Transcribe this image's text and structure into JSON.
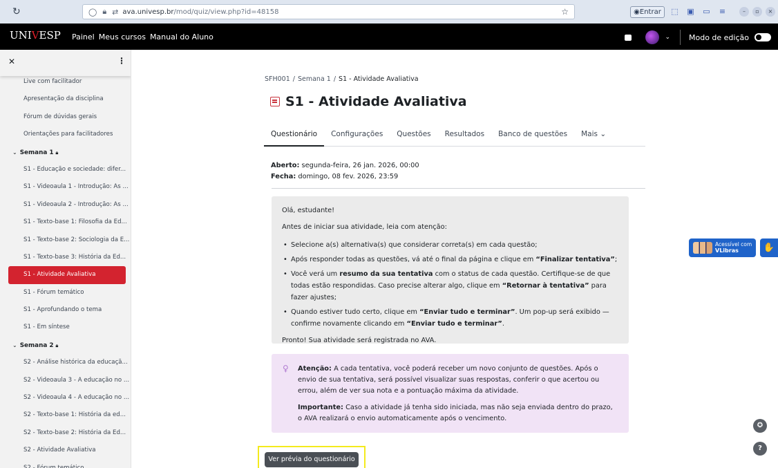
{
  "browser": {
    "url_host": "ava.univesp.br",
    "url_path": "/mod/quiz/view.php?id=48158",
    "entrar_label": "Entrar"
  },
  "navbar": {
    "logo_pre": "UNI",
    "logo_v": "V",
    "logo_post": "ESP",
    "links": [
      "Painel",
      "Meus cursos",
      "Manual do Aluno"
    ],
    "edit_mode_label": "Modo de edição"
  },
  "sidebar": {
    "items_top": [
      "Live com facilitador",
      "Apresentação da disciplina",
      "Fórum de dúvidas gerais",
      "Orientações para facilitadores"
    ],
    "section1": "Semana 1",
    "week1": [
      "S1 - Educação e sociedade: difer...",
      "S1 - Videoaula 1 - Introdução: As ...",
      "S1 - Videoaula 2 - Introdução: As ...",
      "S1 - Texto-base 1: Filosofia da Ed...",
      "S1 - Texto-base 2: Sociologia da E...",
      "S1 - Texto-base 3: História da Ed...",
      "S1 - Atividade Avaliativa",
      "S1 - Fórum temático",
      "S1 - Aprofundando o tema",
      "S1 - Em síntese"
    ],
    "section2": "Semana 2",
    "week2": [
      "S2 - Análise histórica da educaçã...",
      "S2 - Videoaula 3 - A educação no ...",
      "S2 - Videoaula 4 - A educação no ...",
      "S2 - Texto-base 1: História da ed...",
      "S2 - Texto-base 2: História da Ed...",
      "S2 - Atividade Avaliativa",
      "S2 - Fórum temático"
    ]
  },
  "breadcrumb": [
    "SFH001",
    "Semana 1",
    "S1 - Atividade Avaliativa"
  ],
  "title": "S1 - Atividade Avaliativa",
  "tabs": [
    "Questionário",
    "Configurações",
    "Questões",
    "Resultados",
    "Banco de questões",
    "Mais"
  ],
  "dates": {
    "open_label": "Aberto:",
    "open_value": "segunda-feira, 26 jan. 2026, 00:00",
    "close_label": "Fecha:",
    "close_value": "domingo, 08 fev. 2026, 23:59"
  },
  "info": {
    "greeting": "Olá, estudante!",
    "intro": "Antes de iniciar sua atividade, leia com atenção:",
    "b1": "Selecione a(s) alternativa(s) que considerar correta(s) em cada questão;",
    "b2_pre": "Após responder todas as questões, vá até o final da página e clique em ",
    "b2_bold": "“Finalizar tentativa”",
    "b2_post": ";",
    "b3_pre": "Você verá um ",
    "b3_bold1": "resumo da sua tentativa",
    "b3_mid": " com o status de cada questão. Certifique-se de que todas estão respondidas. Caso precise alterar algo, clique em ",
    "b3_bold2": "“Retornar à tentativa”",
    "b3_post": " para fazer ajustes;",
    "b4_pre": "Quando estiver tudo certo, clique em ",
    "b4_bold1": "“Enviar tudo e terminar”",
    "b4_mid": ". Um pop-up será exibido — confirme novamente clicando em ",
    "b4_bold2": "“Enviar tudo e terminar”",
    "b4_post": ".",
    "closing": "Pronto! Sua atividade será registrada no AVA."
  },
  "alert": {
    "p1_bold": "Atenção:",
    "p1_text": " A cada tentativa, você poderá receber um novo conjunto de questões. Após o envio de sua tentativa, será possível visualizar suas respostas, conferir o que acertou ou errou, além de ver sua nota e a pontuação máxima da atividade.",
    "p2_bold": "Importante:",
    "p2_text": " Caso a atividade já tenha sido iniciada, mas não seja enviada dentro do prazo, o AVA realizará o envio automaticamente após o vencimento."
  },
  "preview_button": "Ver prévia do questionário",
  "vlibras": {
    "line1": "Acessível com",
    "line2": "VLibras"
  },
  "help": "?"
}
